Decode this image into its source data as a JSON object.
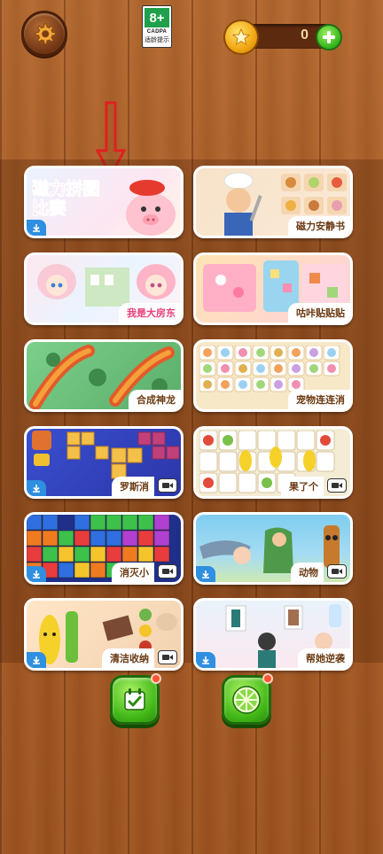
{
  "header": {
    "age_rating": "8+",
    "age_org": "CADPA",
    "age_tip": "适龄提示",
    "coins": "0"
  },
  "games": [
    {
      "title": "磁力拼图比赛",
      "download": true,
      "video": false
    },
    {
      "title": "磁力安静书",
      "download": false,
      "video": false
    },
    {
      "title": "我是大房东",
      "download": false,
      "video": false
    },
    {
      "title": "咕咔贴贴贴",
      "download": false,
      "video": false
    },
    {
      "title": "合成神龙",
      "download": false,
      "video": false
    },
    {
      "title": "宠物连连消",
      "download": false,
      "video": false
    },
    {
      "title": "罗斯消",
      "download": true,
      "video": true
    },
    {
      "title": "果了个",
      "download": false,
      "video": true
    },
    {
      "title": "消灭小",
      "download": true,
      "video": true
    },
    {
      "title": "动物",
      "download": true,
      "video": true
    },
    {
      "title": "清洁收纳",
      "download": true,
      "video": true
    },
    {
      "title": "帮她逆袭",
      "download": true,
      "video": false
    }
  ],
  "colors": {
    "wood": "#a85c26",
    "accent_green": "#42b818",
    "coin_gold": "#f1a612",
    "arrow_red": "#e02020"
  }
}
